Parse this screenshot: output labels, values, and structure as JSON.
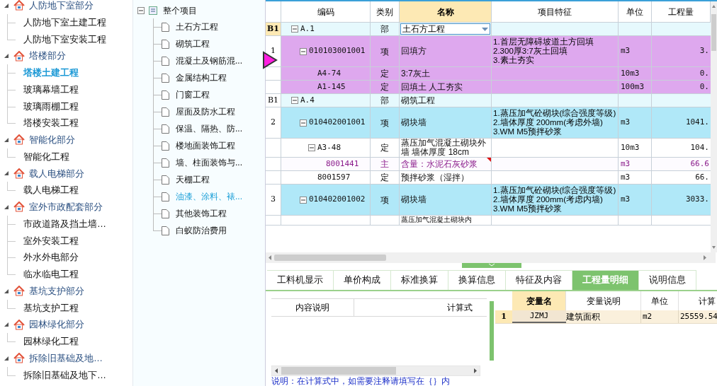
{
  "project_tree": [
    {
      "label": "人防地下室部分",
      "expanded": true,
      "children": [
        {
          "label": "人防地下室土建工程",
          "selected": false
        },
        {
          "label": "人防地下室安装工程",
          "selected": false
        }
      ]
    },
    {
      "label": "塔楼部分",
      "expanded": true,
      "children": [
        {
          "label": "塔楼土建工程",
          "selected": true
        },
        {
          "label": "玻璃幕墙工程",
          "selected": false
        },
        {
          "label": "玻璃雨棚工程",
          "selected": false
        },
        {
          "label": "塔楼安装工程",
          "selected": false
        }
      ]
    },
    {
      "label": "智能化部分",
      "expanded": true,
      "children": [
        {
          "label": "智能化工程",
          "selected": false
        }
      ]
    },
    {
      "label": "载人电梯部分",
      "expanded": true,
      "children": [
        {
          "label": "载人电梯工程",
          "selected": false
        }
      ]
    },
    {
      "label": "室外市政配套部分",
      "expanded": true,
      "children": [
        {
          "label": "市政道路及挡土墙…",
          "selected": false
        },
        {
          "label": "室外安装工程",
          "selected": false
        },
        {
          "label": "外水外电部分",
          "selected": false
        },
        {
          "label": "临水临电工程",
          "selected": false
        }
      ]
    },
    {
      "label": "基坑支护部分",
      "expanded": true,
      "children": [
        {
          "label": "基坑支护工程",
          "selected": false
        }
      ]
    },
    {
      "label": "园林绿化部分",
      "expanded": true,
      "children": [
        {
          "label": "园林绿化工程",
          "selected": false
        }
      ]
    },
    {
      "label": "拆除旧基础及地…",
      "expanded": true,
      "children": [
        {
          "label": "拆除旧基础及地下…",
          "selected": false
        }
      ]
    }
  ],
  "section_tree": {
    "label": "整个项目",
    "expanded": true,
    "children": [
      {
        "label": "土石方工程",
        "selected": false
      },
      {
        "label": "砌筑工程",
        "selected": false
      },
      {
        "label": "混凝土及钢筋混...",
        "selected": false
      },
      {
        "label": "金属结构工程",
        "selected": false
      },
      {
        "label": "门窗工程",
        "selected": false
      },
      {
        "label": "屋面及防水工程",
        "selected": false
      },
      {
        "label": "保温、隔热、防...",
        "selected": false
      },
      {
        "label": "楼地面装饰工程",
        "selected": false
      },
      {
        "label": "墙、柱面装饰与...",
        "selected": false
      },
      {
        "label": "天棚工程",
        "selected": false
      },
      {
        "label": "油漆、涂料、裱...",
        "selected": true
      },
      {
        "label": "其他装饰工程",
        "selected": false
      },
      {
        "label": "白蚁防治费用",
        "selected": false
      }
    ]
  },
  "grid": {
    "columns": [
      {
        "label": "编码",
        "selected": false
      },
      {
        "label": "类别",
        "selected": false
      },
      {
        "label": "名称",
        "selected": true
      },
      {
        "label": "项目特征",
        "selected": false
      },
      {
        "label": "单位",
        "selected": false
      },
      {
        "label": "工程量",
        "selected": false
      }
    ],
    "rows": [
      {
        "kind": "section",
        "index": "B1",
        "current": true,
        "selected": false,
        "expanded": true,
        "code": "A.1",
        "type": "部",
        "name": "土石方工程",
        "editing": true,
        "children": [
          {
            "kind": "item",
            "index": "1",
            "current": false,
            "selected": true,
            "expanded": true,
            "code": "010103001001",
            "type": "项",
            "name": "回填方",
            "features": [
              "1.首层无障碍坡道土方回填",
              "2.300厚3:7灰土回填",
              "3.素土夯实"
            ],
            "unit": "m3",
            "quantity": "3.",
            "children": [
              {
                "kind": "quota",
                "selected": true,
                "code": "A4-74",
                "type": "定",
                "name": "3:7灰土",
                "unit": "10m3",
                "quantity": "0."
              },
              {
                "kind": "quota",
                "selected": true,
                "code": "A1-145",
                "type": "定",
                "name": "回填土 人工夯实",
                "unit": "100m3",
                "quantity": "0."
              }
            ]
          }
        ]
      },
      {
        "kind": "section",
        "index": "B1",
        "current": false,
        "selected": false,
        "expanded": true,
        "code": "A.4",
        "type": "部",
        "name": "砌筑工程",
        "children": [
          {
            "kind": "item",
            "index": "2",
            "current": false,
            "selected": false,
            "expanded": true,
            "code": "010402001001",
            "type": "项",
            "name": "砌块墙",
            "features": [
              "1.蒸压加气砼砌块(综合强度等级)",
              "2.墙体厚度 200mm(考虑外墙)",
              "3.WM M5预拌砂浆"
            ],
            "unit": "m3",
            "quantity": "1041.",
            "children": [
              {
                "kind": "quota",
                "selected": false,
                "expanded": true,
                "code": "A3-48",
                "type": "定",
                "name": "蒸压加气混凝土砌块外墙 墙体厚度 18cm",
                "unit": "10m3",
                "quantity": "104.",
                "children": [
                  {
                    "kind": "material",
                    "selected": false,
                    "code": "8001441",
                    "type": "主",
                    "name": "含量：水泥石灰砂浆",
                    "has_note": true,
                    "unit": "m3",
                    "quantity": "66.6"
                  }
                ]
              },
              {
                "kind": "quota",
                "selected": false,
                "code": "8001597",
                "type": "定",
                "name": "预拌砂浆（湿拌）",
                "unit": "m3",
                "quantity": "66."
              }
            ]
          },
          {
            "kind": "item",
            "index": "3",
            "current": false,
            "selected": false,
            "expanded": true,
            "code": "010402001002",
            "type": "项",
            "name": "砌块墙",
            "features": [
              "1.蒸压加气砼砌块(综合强度等级)",
              "2.墙体厚度 200mm(考虑内墙)",
              "3.WM M5预拌砂浆"
            ],
            "unit": "m3",
            "quantity": "3033.",
            "children": [
              {
                "kind": "quota",
                "selected": false,
                "name": "蒸压加气混凝土砌块内"
              }
            ]
          }
        ]
      }
    ]
  },
  "detail_tabs": [
    {
      "label": "工料机显示",
      "selected": false
    },
    {
      "label": "单价构成",
      "selected": false
    },
    {
      "label": "标准换算",
      "selected": false
    },
    {
      "label": "换算信息",
      "selected": false
    },
    {
      "label": "特征及内容",
      "selected": false
    },
    {
      "label": "工程量明细",
      "selected": true
    },
    {
      "label": "说明信息",
      "selected": false
    }
  ],
  "formula_table": {
    "columns": [
      "内容说明",
      "计算式"
    ]
  },
  "variables_table": {
    "columns": [
      {
        "label": "变量名",
        "selected": true
      },
      {
        "label": "变量说明",
        "selected": false
      },
      {
        "label": "单位",
        "selected": false
      },
      {
        "label": "计算",
        "selected": false
      }
    ],
    "rows": [
      {
        "index": "1",
        "name": "JZMJ",
        "description": "建筑面积",
        "unit": "m2",
        "formula": "25559.54"
      }
    ]
  },
  "hint": "说明：在计算式中，如需要注释请填写在｛｝内"
}
